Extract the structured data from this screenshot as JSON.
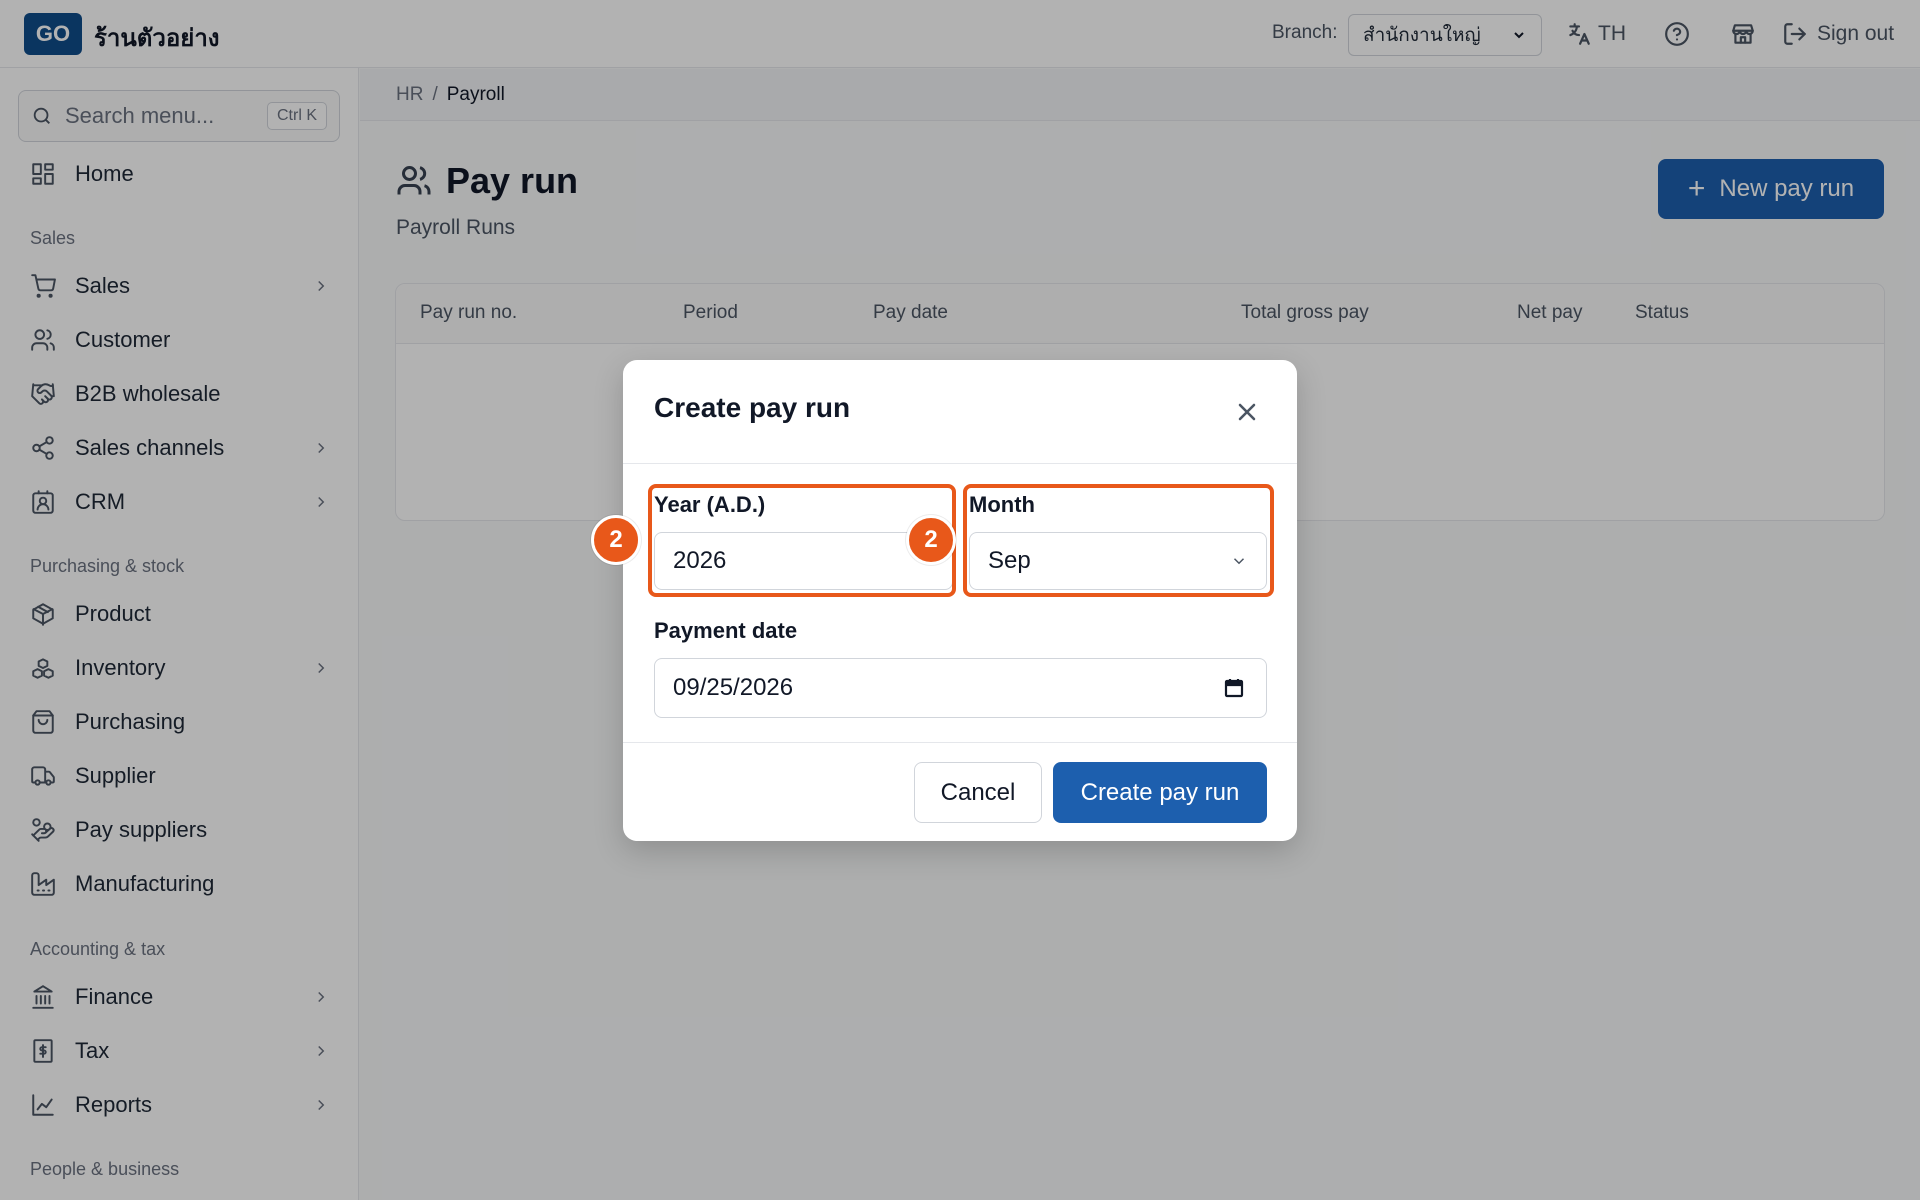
{
  "topbar": {
    "logo": "GO",
    "shop_name": "ร้านตัวอย่าง",
    "branch_label": "Branch:",
    "branch_value": "สำนักงานใหญ่",
    "language": "TH",
    "sign_out": "Sign out"
  },
  "sidebar": {
    "search_placeholder": "Search menu...",
    "search_shortcut": "Ctrl K",
    "home": "Home",
    "sections": {
      "sales": "Sales",
      "purchasing": "Purchasing & stock",
      "accounting": "Accounting & tax",
      "people": "People & business"
    },
    "items": [
      {
        "label": "Sales",
        "icon": "cart-icon",
        "expandable": true
      },
      {
        "label": "Customer",
        "icon": "users-icon",
        "expandable": false
      },
      {
        "label": "B2B wholesale",
        "icon": "handshake-icon",
        "expandable": false
      },
      {
        "label": "Sales channels",
        "icon": "share-icon",
        "expandable": true
      },
      {
        "label": "CRM",
        "icon": "contact-card-icon",
        "expandable": true
      },
      {
        "label": "Product",
        "icon": "package-icon",
        "expandable": false
      },
      {
        "label": "Inventory",
        "icon": "boxes-icon",
        "expandable": true
      },
      {
        "label": "Purchasing",
        "icon": "shopping-bag-icon",
        "expandable": false
      },
      {
        "label": "Supplier",
        "icon": "truck-icon",
        "expandable": false
      },
      {
        "label": "Pay suppliers",
        "icon": "hand-coins-icon",
        "expandable": false
      },
      {
        "label": "Manufacturing",
        "icon": "factory-icon",
        "expandable": false
      },
      {
        "label": "Finance",
        "icon": "bank-icon",
        "expandable": true
      },
      {
        "label": "Tax",
        "icon": "receipt-icon",
        "expandable": true
      },
      {
        "label": "Reports",
        "icon": "chart-line-icon",
        "expandable": true
      }
    ]
  },
  "breadcrumb": {
    "parent": "HR",
    "separator": "/",
    "current": "Payroll"
  },
  "page": {
    "title": "Pay run",
    "subtitle": "Payroll Runs",
    "new_button": "New pay run"
  },
  "table": {
    "columns": [
      "Pay run no.",
      "Period",
      "Pay date",
      "Total gross pay",
      "Net pay",
      "Status"
    ]
  },
  "modal": {
    "title": "Create pay run",
    "year_label": "Year (A.D.)",
    "year_value": "2026",
    "month_label": "Month",
    "month_value": "Sep",
    "payment_date_label": "Payment date",
    "payment_date_value": "09/25/2026",
    "cancel": "Cancel",
    "submit": "Create pay run",
    "step_badge": "2"
  },
  "colors": {
    "brand": "#1d5fae",
    "highlight": "#e8581a"
  }
}
